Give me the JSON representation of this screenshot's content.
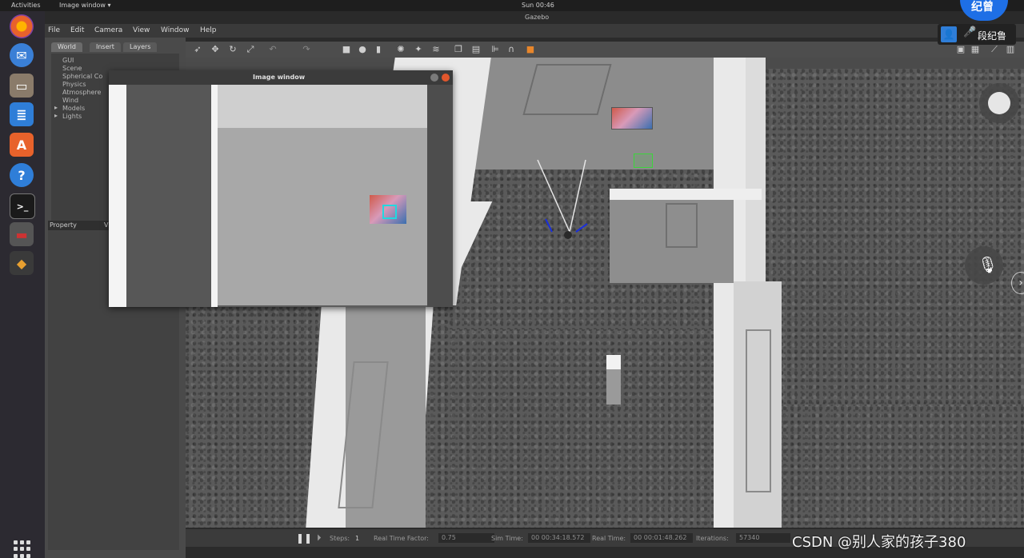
{
  "topbar": {
    "activities": "Activities",
    "window_menu": "Image window ▾",
    "clock": "Sun 00:46"
  },
  "gazebo": {
    "title": "Gazebo",
    "menu": [
      "File",
      "Edit",
      "Camera",
      "View",
      "Window",
      "Help"
    ],
    "tabs": [
      "World",
      "Insert",
      "Layers"
    ],
    "tree": [
      "GUI",
      "Scene",
      "Spherical Co",
      "Physics",
      "Atmosphere",
      "Wind",
      "Models",
      "Lights"
    ],
    "property_header": "Property",
    "property_value_col": "V",
    "toolbar_icons": [
      "select-icon",
      "translate-icon",
      "rotate-icon",
      "scale-icon",
      "undo-icon",
      "redo-icon",
      "box-icon",
      "sphere-icon",
      "cylinder-icon",
      "point-light-icon",
      "spot-light-icon",
      "directional-light-icon",
      "copy-icon",
      "paste-icon",
      "align-icon",
      "snap-icon",
      "record-icon"
    ]
  },
  "status": {
    "steps_label": "Steps:",
    "steps_value": "1",
    "rtf_label": "Real Time Factor:",
    "rtf_value": "0.75",
    "sim_label": "Sim Time:",
    "sim_value": "00 00:34:18.572",
    "real_label": "Real Time:",
    "real_value": "00 00:01:48.262",
    "iter_label": "Iterations:",
    "iter_value": "57340"
  },
  "image_window": {
    "title": "Image window"
  },
  "meeting": {
    "top_label": "纪曾",
    "user_name": "段纪鲁"
  },
  "watermark": "CSDN @别人家的孩子380",
  "colors": {
    "accent_blue": "#1e6fe6",
    "close_orange": "#e2572c",
    "gz_green": "#38c238"
  }
}
